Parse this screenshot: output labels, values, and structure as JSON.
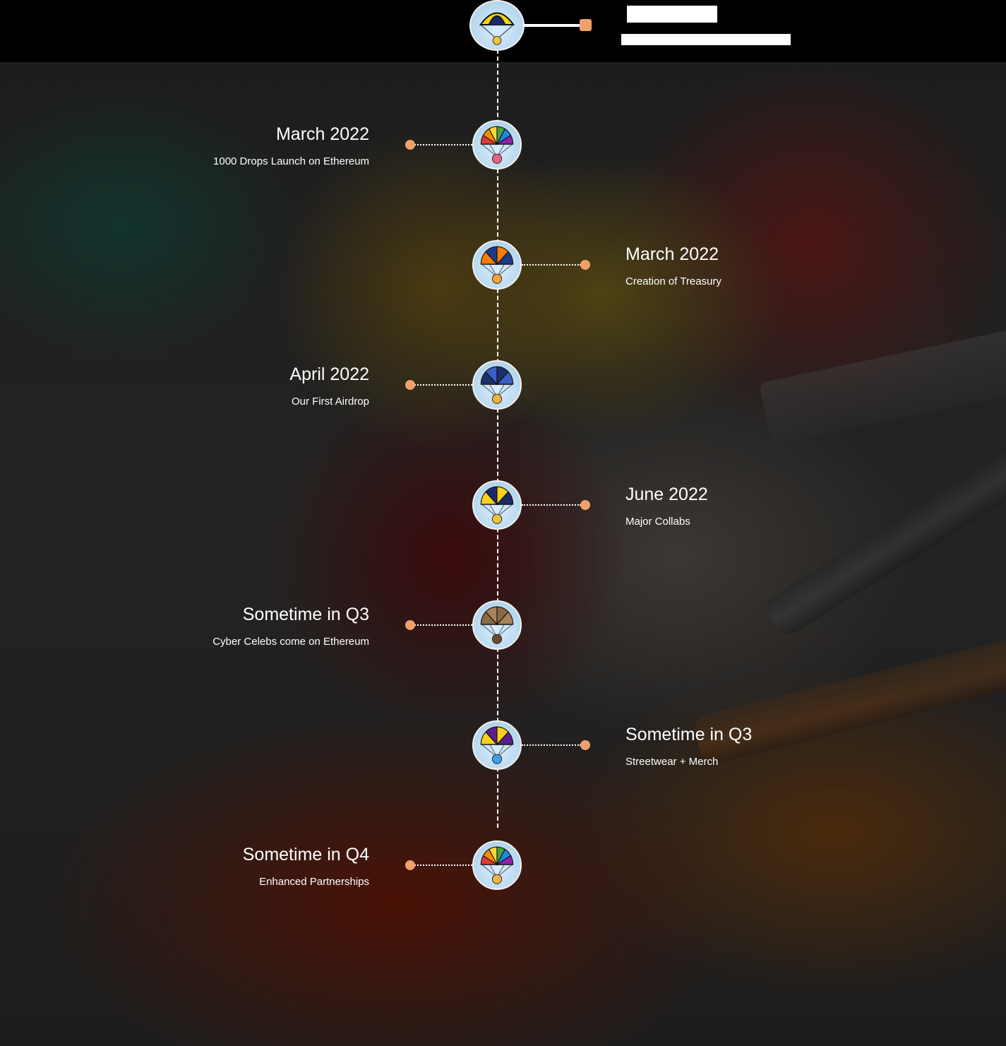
{
  "colors": {
    "accent": "#f0a06a",
    "text": "#ffffff",
    "background": "#1e1e1e"
  },
  "timeline": [
    {
      "date": "March 2022",
      "text": "1000 Drops Launch on Ethereum",
      "side": "left",
      "icon": "parachute-rainbow-icon"
    },
    {
      "date": "March 2022",
      "text": "Creation of Treasury",
      "side": "right",
      "icon": "parachute-orange-blue-icon"
    },
    {
      "date": "April 2022",
      "text": "Our First Airdrop",
      "side": "left",
      "icon": "parachute-navy-icon"
    },
    {
      "date": "June 2022",
      "text": "Major Collabs",
      "side": "right",
      "icon": "parachute-yellow-navy-icon"
    },
    {
      "date": "Sometime in Q3",
      "text": "Cyber Celebs come on Ethereum",
      "side": "left",
      "icon": "parachute-burlap-icon"
    },
    {
      "date": "Sometime in Q3",
      "text": "Streetwear + Merch",
      "side": "right",
      "icon": "parachute-yellow-purple-icon"
    },
    {
      "date": "Sometime in Q4",
      "text": "Enhanced Partnerships",
      "side": "left",
      "icon": "parachute-rainbow-icon"
    }
  ]
}
